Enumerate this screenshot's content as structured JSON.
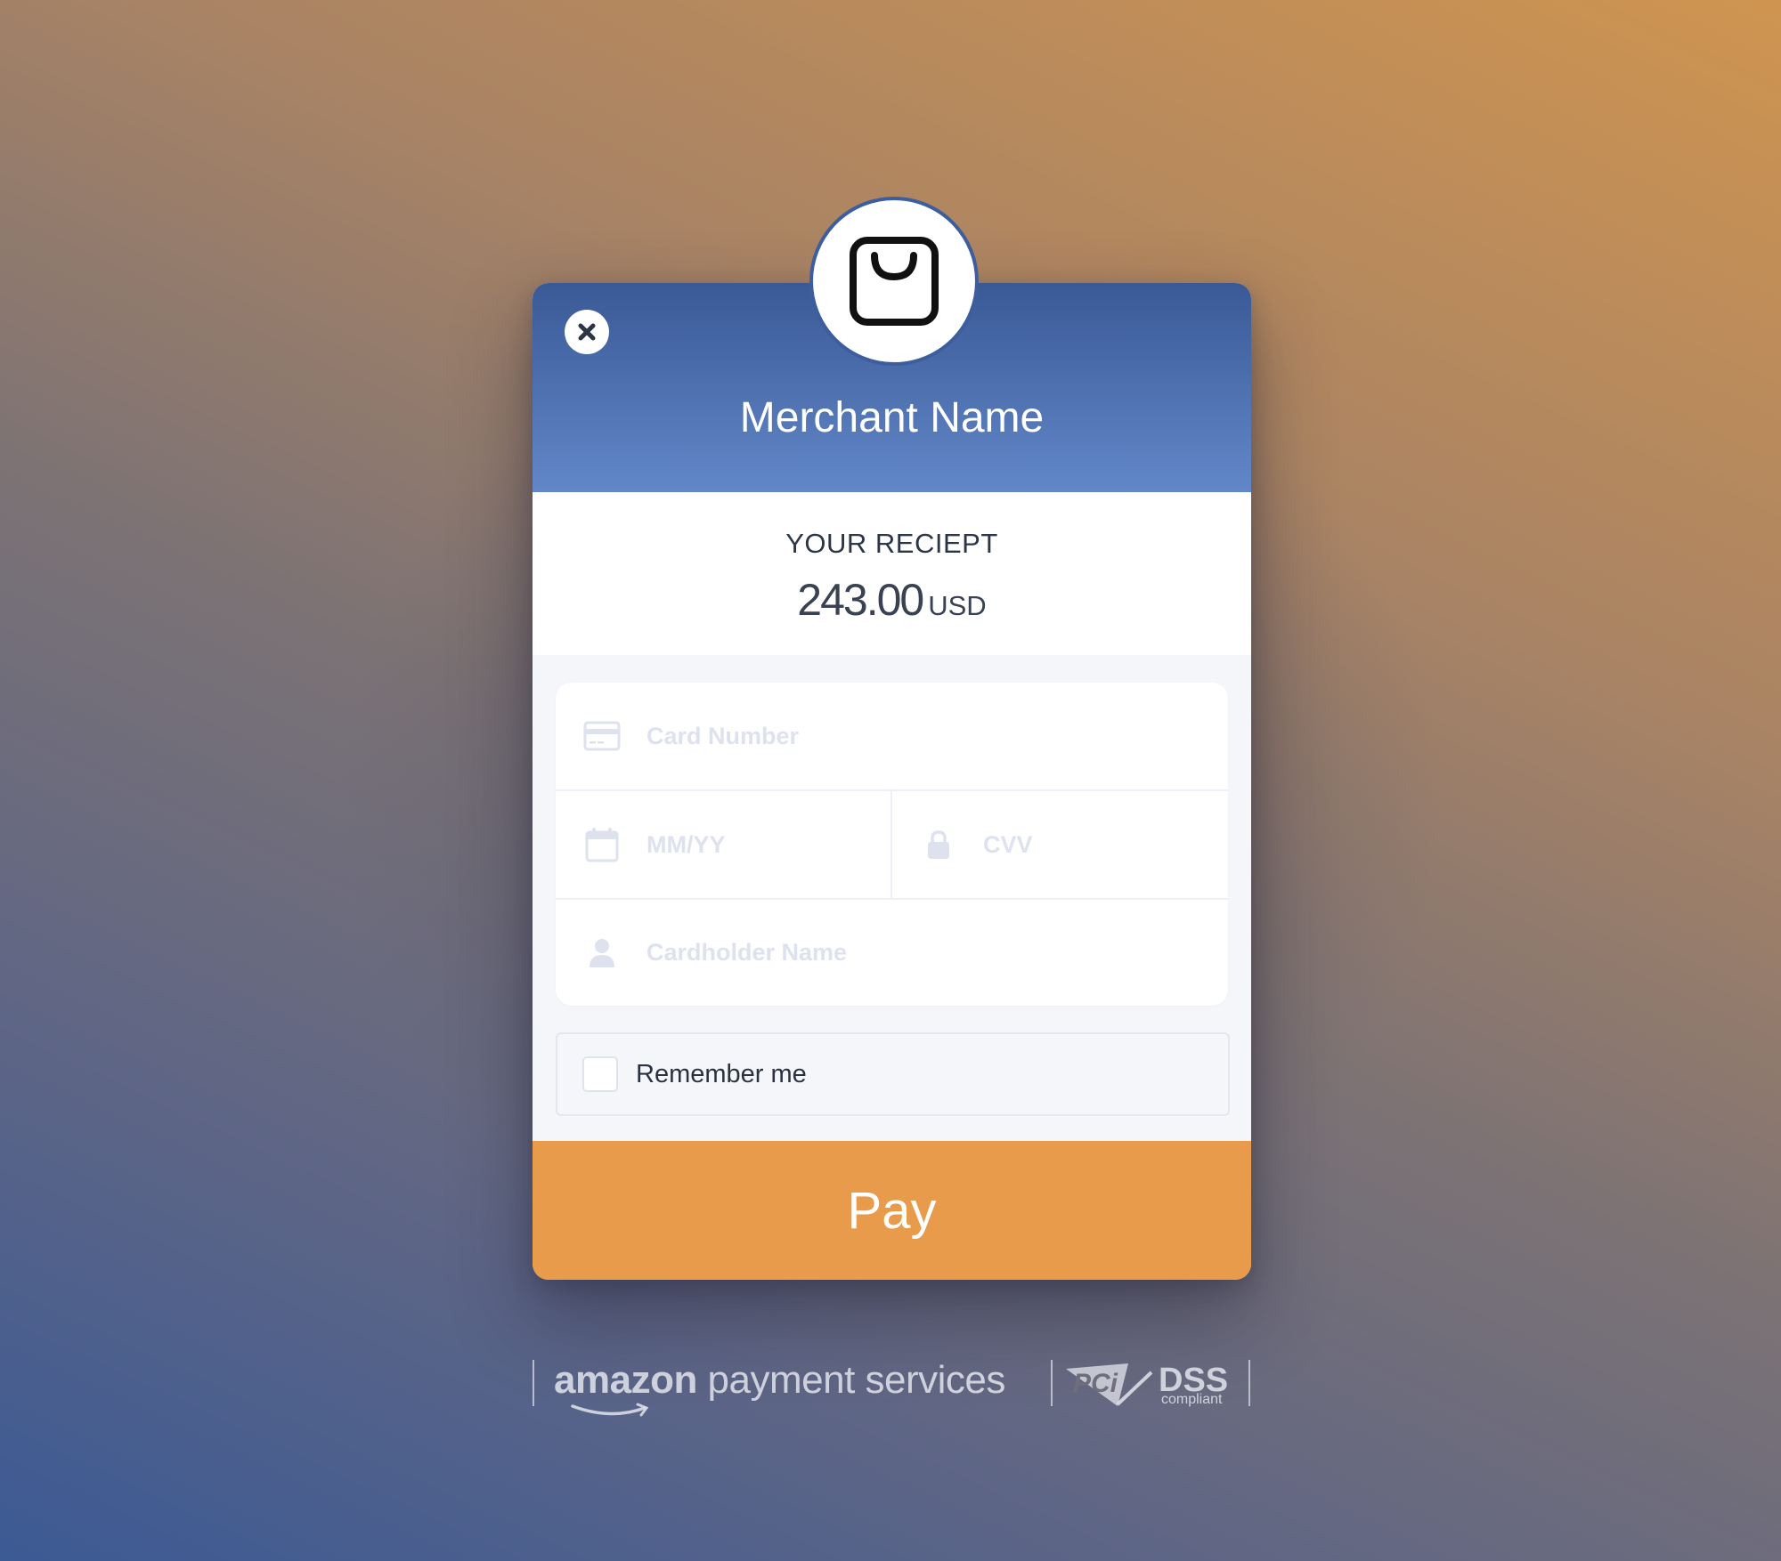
{
  "header": {
    "merchant_name": "Merchant Name",
    "logo_icon": "shopping-bag-icon",
    "close_icon": "close-icon"
  },
  "receipt": {
    "title": "YOUR RECIEPT",
    "amount": "243.00",
    "currency": "USD"
  },
  "form": {
    "card_number": {
      "placeholder": "Card Number",
      "value": "",
      "icon": "credit-card-icon"
    },
    "expiry": {
      "placeholder": "MM/YY",
      "value": "",
      "icon": "calendar-icon"
    },
    "cvv": {
      "placeholder": "CVV",
      "value": "",
      "icon": "lock-icon"
    },
    "cardholder": {
      "placeholder": "Cardholder Name",
      "value": "",
      "icon": "user-icon"
    },
    "remember_me": {
      "label": "Remember me",
      "checked": false
    }
  },
  "pay_button": {
    "label": "Pay"
  },
  "footer": {
    "amazon_bold": "amazon",
    "amazon_rest": " payment services",
    "pci_logo": "PCi",
    "dss": "DSS",
    "compliant": "compliant"
  },
  "colors": {
    "header_top": "#3a5996",
    "header_bottom": "#6287c8",
    "pay_button": "#e89b4a",
    "placeholder": "#dde2ee"
  }
}
